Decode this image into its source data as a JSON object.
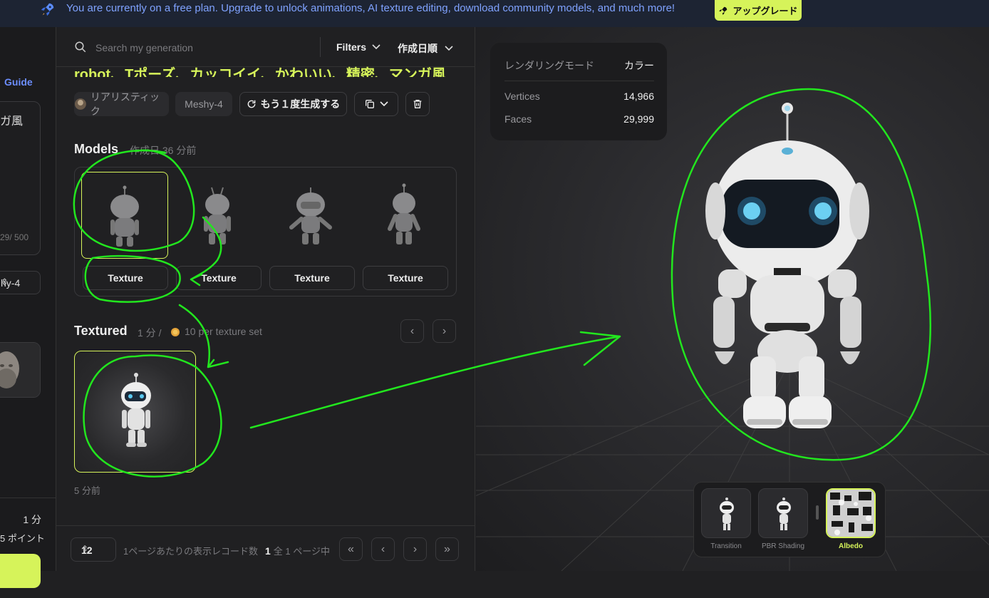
{
  "banner": {
    "message": "You are currently on a free plan. Upgrade to unlock animations, AI texture editing, download community models, and much more!",
    "upgrade_label": "アップグレード",
    "icon": "rocket-icon"
  },
  "left_panel": {
    "guide_label": "Guide",
    "prompt_fragment": "ガ風",
    "char_count": "29/ 500",
    "model_label": "hy-4",
    "credit_time": "1 分",
    "credit_points": "5 ポイント"
  },
  "search": {
    "placeholder": "Search my generation",
    "filters_label": "Filters",
    "sort_label": "作成日順"
  },
  "generation": {
    "prompt": "robot、Tポーズ、カッコイイ、かわいい、精密、マンガ風",
    "tags": {
      "style": "リアリスティック",
      "model": "Meshy-4"
    },
    "regenerate_label": "もう１度生成する"
  },
  "models": {
    "heading": "Models",
    "created": "作成日 36 分前",
    "texture_buttons": [
      "Texture",
      "Texture",
      "Texture",
      "Texture"
    ]
  },
  "textured": {
    "heading": "Textured",
    "time_cost": "1 分 /",
    "credit_cost": "10 per texture set",
    "created": "5 分前"
  },
  "pagination": {
    "page_size": "12",
    "per_page_label": "1ページあたりの表示レコード数",
    "current_page": "1",
    "total_label": "全 1 ページ中",
    "first": "«",
    "prev": "‹",
    "next": "›",
    "last": "»"
  },
  "viewer": {
    "render_mode_label": "レンダリングモード",
    "render_mode_value": "カラー",
    "vertices_label": "Vertices",
    "vertices_value": "14,966",
    "faces_label": "Faces",
    "faces_value": "29,999",
    "modes": [
      "Transition",
      "PBR Shading",
      "Albedo"
    ],
    "selected_mode": "Albedo"
  },
  "colors": {
    "accent": "#d6f35a",
    "banner_text": "#7fa2ff",
    "annotation": "#22e61e"
  }
}
